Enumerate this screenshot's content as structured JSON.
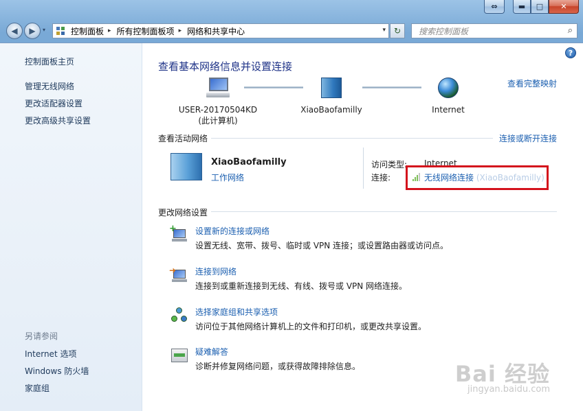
{
  "window": {
    "buttons": {
      "restore": "⇔",
      "minimize": "▬",
      "maximize": "□",
      "close": "✕"
    }
  },
  "nav": {
    "back": "◀",
    "forward": "▶",
    "dropdown": "▾",
    "breadcrumbs": [
      "控制面板",
      "所有控制面板项",
      "网络和共享中心"
    ],
    "breadcrumb_sep": "▸",
    "refresh": "↻",
    "search_placeholder": "搜索控制面板",
    "search_icon": "⌕"
  },
  "sidebar": {
    "home": "控制面板主页",
    "links": [
      "管理无线网络",
      "更改适配器设置",
      "更改高级共享设置"
    ],
    "see_also_heading": "另请参阅",
    "see_also": [
      "Internet 选项",
      "Windows 防火墙",
      "家庭组"
    ]
  },
  "main": {
    "help_icon": "?",
    "title": "查看基本网络信息并设置连接",
    "full_map_link": "查看完整映射",
    "network_map": {
      "computer_name": "USER-20170504KD",
      "computer_sub": "(此计算机)",
      "network_name": "XiaoBaofamilly",
      "internet_label": "Internet"
    },
    "active_section": {
      "heading": "查看活动网络",
      "connect_link": "连接或断开连接",
      "network_name": "XiaoBaofamilly",
      "network_type": "工作网络",
      "access_type_label": "访问类型:",
      "access_type_value": "Internet",
      "connection_label": "连接:",
      "connection_link": "无线网络连接",
      "connection_ssid": "(XiaoBaofamilly)"
    },
    "change_section": {
      "heading": "更改网络设置",
      "tasks": [
        {
          "title": "设置新的连接或网络",
          "desc": "设置无线、宽带、拨号、临时或 VPN 连接；或设置路由器或访问点。"
        },
        {
          "title": "连接到网络",
          "desc": "连接到或重新连接到无线、有线、拨号或 VPN 网络连接。"
        },
        {
          "title": "选择家庭组和共享选项",
          "desc": "访问位于其他网络计算机上的文件和打印机，或更改共享设置。"
        },
        {
          "title": "疑难解答",
          "desc": "诊断并修复网络问题，或获得故障排除信息。"
        }
      ]
    }
  },
  "watermark": {
    "main": "Bai 经验",
    "sub": "jingyan.baidu.com"
  }
}
